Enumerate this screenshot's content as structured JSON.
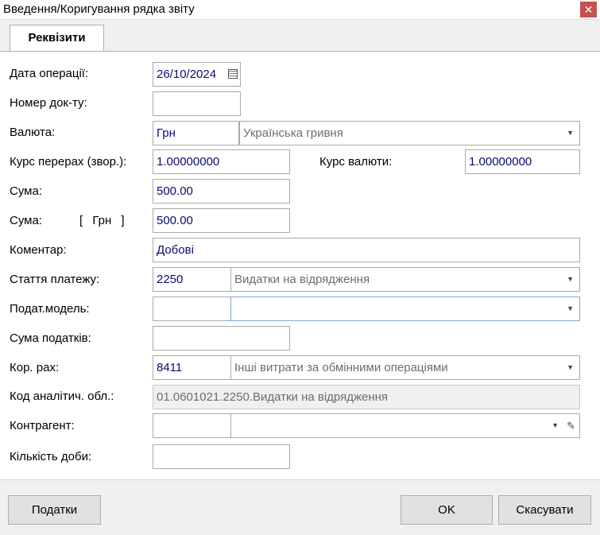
{
  "window": {
    "title": "Введення/Коригування рядка звіту",
    "close_glyph": "✕"
  },
  "tabs": [
    {
      "label": "Реквізити"
    }
  ],
  "form": {
    "operation_date": {
      "label": "Дата операції:",
      "value": "26/10/2024"
    },
    "doc_number": {
      "label": "Номер док-ту:",
      "value": ""
    },
    "currency": {
      "label": "Валюта:",
      "code": "Грн",
      "name": "Українська гривня"
    },
    "rate_reverse": {
      "label": "Курс перерах (звор.):",
      "value": "1.00000000"
    },
    "currency_rate": {
      "label": "Курс валюти:",
      "value": "1.00000000"
    },
    "amount": {
      "label": "Сума:",
      "value": "500.00"
    },
    "amount_currency": {
      "label": "Сума:",
      "currency_bracket": "[ Грн ]",
      "value": "500.00"
    },
    "comment": {
      "label": "Коментар:",
      "value": "Добові"
    },
    "payment_item": {
      "label": "Стаття платежу:",
      "code": "2250",
      "name": "Видатки на відрядження"
    },
    "tax_model": {
      "label": "Подат.модель:",
      "code": "",
      "name": ""
    },
    "tax_amount": {
      "label": "Сума податків:",
      "value": ""
    },
    "corr_account": {
      "label": "Кор. рах:",
      "code": "8411",
      "name": "Інші витрати за обмінними операціями"
    },
    "analytic_code": {
      "label": "Код аналітич. обл.:",
      "value": "01.0601021.2250.Видатки на відрядження"
    },
    "counterparty": {
      "label": "Контрагент:",
      "code": "",
      "name": ""
    },
    "days_count": {
      "label": "Кількість доби:",
      "value": ""
    }
  },
  "buttons": {
    "taxes": "Податки",
    "ok": "OK",
    "cancel": "Скасувати"
  },
  "icons": {
    "dropdown": "chevron-down-icon",
    "calendar": "calendar-icon",
    "edit": "pencil-icon"
  }
}
